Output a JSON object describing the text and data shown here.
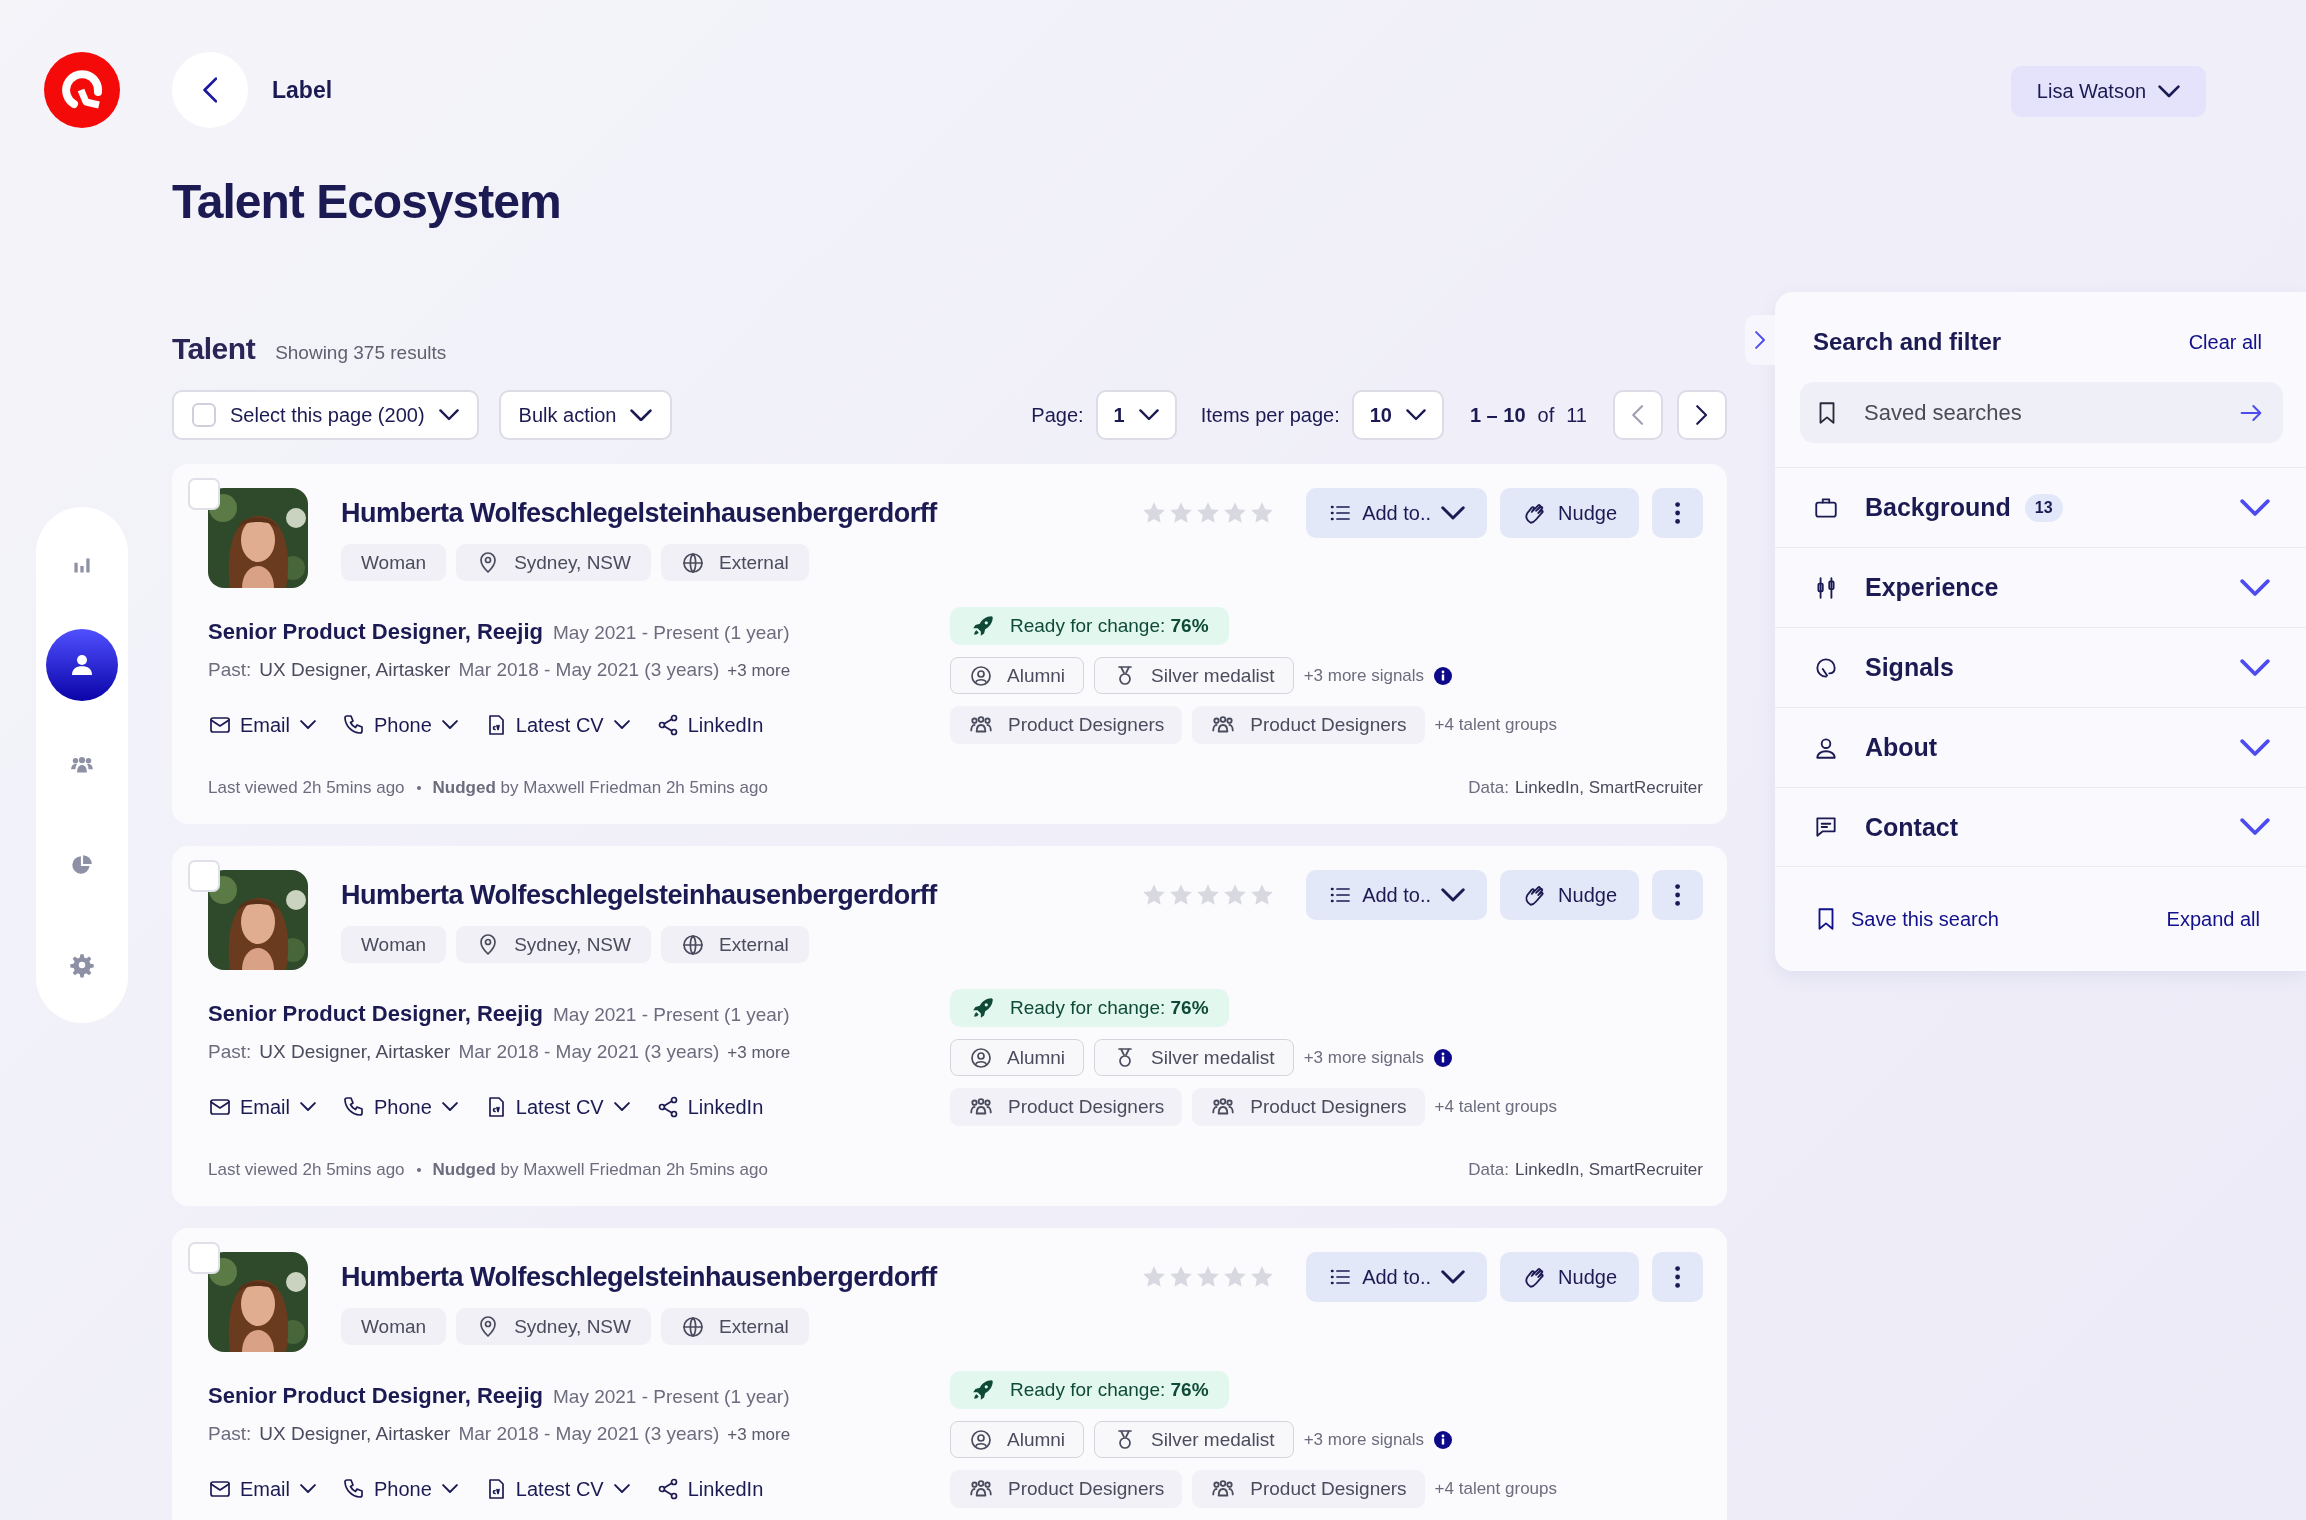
{
  "header": {
    "back_label": "Label",
    "user": "Lisa Watson"
  },
  "title": "Talent Ecosystem",
  "nav": [
    {
      "kind": "chart",
      "selected": false
    },
    {
      "kind": "person",
      "selected": true
    },
    {
      "kind": "people",
      "selected": false
    },
    {
      "kind": "pie",
      "selected": false
    },
    {
      "kind": "settings",
      "selected": false
    }
  ],
  "talent": {
    "heading": "Talent",
    "count": "Showing 375 results"
  },
  "toolbar": {
    "select_page": {
      "label": "Select this page (200)",
      "checked": false
    },
    "bulk_action": "Bulk action",
    "page_label": "Page:",
    "page": "1",
    "items_label": "Items per page:",
    "items": "10",
    "range": "1 – 10",
    "of": "of",
    "total": "11",
    "prev_disabled": true
  },
  "cards": [
    {
      "checked": false,
      "name": "Humberta Wolfeschlegelsteinhausenbergerdorff",
      "stars": 0,
      "tags": [
        {
          "kind": "plain",
          "label": "Woman"
        },
        {
          "kind": "location",
          "label": "Sydney, NSW"
        },
        {
          "kind": "globe",
          "label": "External"
        }
      ],
      "current": {
        "role": "Senior Product Designer, Reejig",
        "dates": "May 2021 - Present (1 year)"
      },
      "past": {
        "label": "Past:",
        "role": "UX Designer, Airtasker",
        "dates": "Mar 2018 - May 2021 (3 years)",
        "more": "+3 more"
      },
      "links": [
        {
          "kind": "email",
          "label": "Email",
          "dropdown": true
        },
        {
          "kind": "phone",
          "label": "Phone",
          "dropdown": true
        },
        {
          "kind": "cv",
          "label": "Latest CV",
          "dropdown": true
        },
        {
          "kind": "share",
          "label": "LinkedIn",
          "dropdown": false
        }
      ],
      "actions": {
        "add": "Add to..",
        "nudge": "Nudge"
      },
      "readiness": "Ready for change: **76%**",
      "signals": [
        {
          "kind": "alumni",
          "label": "Alumni"
        },
        {
          "kind": "medal",
          "label": "Silver medalist"
        }
      ],
      "more_signals": "+3 more signals",
      "groups": [
        "Product Designers",
        "Product Designers"
      ],
      "more_groups": "+4 talent groups",
      "footer": {
        "viewed": "Last viewed 2h 5mins ago",
        "nudged": "**Nudged** by Maxwell Friedman 2h 5mins ago",
        "data_label": "Data:",
        "sources": "LinkedIn, SmartRecruiter"
      }
    },
    {
      "checked": false,
      "name": "Humberta Wolfeschlegelsteinhausenbergerdorff",
      "stars": 0,
      "tags": [
        {
          "kind": "plain",
          "label": "Woman"
        },
        {
          "kind": "location",
          "label": "Sydney, NSW"
        },
        {
          "kind": "globe",
          "label": "External"
        }
      ],
      "current": {
        "role": "Senior Product Designer, Reejig",
        "dates": "May 2021 - Present (1 year)"
      },
      "past": {
        "label": "Past:",
        "role": "UX Designer, Airtasker",
        "dates": "Mar 2018 - May 2021 (3 years)",
        "more": "+3 more"
      },
      "links": [
        {
          "kind": "email",
          "label": "Email",
          "dropdown": true
        },
        {
          "kind": "phone",
          "label": "Phone",
          "dropdown": true
        },
        {
          "kind": "cv",
          "label": "Latest CV",
          "dropdown": true
        },
        {
          "kind": "share",
          "label": "LinkedIn",
          "dropdown": false
        }
      ],
      "actions": {
        "add": "Add to..",
        "nudge": "Nudge"
      },
      "readiness": "Ready for change: **76%**",
      "signals": [
        {
          "kind": "alumni",
          "label": "Alumni"
        },
        {
          "kind": "medal",
          "label": "Silver medalist"
        }
      ],
      "more_signals": "+3 more signals",
      "groups": [
        "Product Designers",
        "Product Designers"
      ],
      "more_groups": "+4 talent groups",
      "footer": {
        "viewed": "Last viewed 2h 5mins ago",
        "nudged": "**Nudged** by Maxwell Friedman 2h 5mins ago",
        "data_label": "Data:",
        "sources": "LinkedIn, SmartRecruiter"
      }
    },
    {
      "checked": false,
      "name": "Humberta Wolfeschlegelsteinhausenbergerdorff",
      "stars": 0,
      "tags": [
        {
          "kind": "plain",
          "label": "Woman"
        },
        {
          "kind": "location",
          "label": "Sydney, NSW"
        },
        {
          "kind": "globe",
          "label": "External"
        }
      ],
      "current": {
        "role": "Senior Product Designer, Reejig",
        "dates": "May 2021 - Present (1 year)"
      },
      "past": {
        "label": "Past:",
        "role": "UX Designer, Airtasker",
        "dates": "Mar 2018 - May 2021 (3 years)",
        "more": "+3 more"
      },
      "links": [
        {
          "kind": "email",
          "label": "Email",
          "dropdown": true
        },
        {
          "kind": "phone",
          "label": "Phone",
          "dropdown": true
        },
        {
          "kind": "cv",
          "label": "Latest CV",
          "dropdown": true
        },
        {
          "kind": "share",
          "label": "LinkedIn",
          "dropdown": false
        }
      ],
      "actions": {
        "add": "Add to..",
        "nudge": "Nudge"
      },
      "readiness": "Ready for change: **76%**",
      "signals": [
        {
          "kind": "alumni",
          "label": "Alumni"
        },
        {
          "kind": "medal",
          "label": "Silver medalist"
        }
      ],
      "more_signals": "+3 more signals",
      "groups": [
        "Product Designers",
        "Product Designers"
      ],
      "more_groups": "+4 talent groups"
    }
  ],
  "filter": {
    "title": "Search and filter",
    "clear": "Clear all",
    "saved": "Saved searches",
    "sections": [
      {
        "kind": "briefcase",
        "label": "Background",
        "count": "13",
        "expanded": false
      },
      {
        "kind": "sliders",
        "label": "Experience",
        "expanded": false
      },
      {
        "kind": "signal",
        "label": "Signals",
        "expanded": false
      },
      {
        "kind": "user",
        "label": "About",
        "expanded": false
      },
      {
        "kind": "chat",
        "label": "Contact",
        "expanded": false
      }
    ],
    "save": "Save this search",
    "expand_all": "Expand all"
  }
}
